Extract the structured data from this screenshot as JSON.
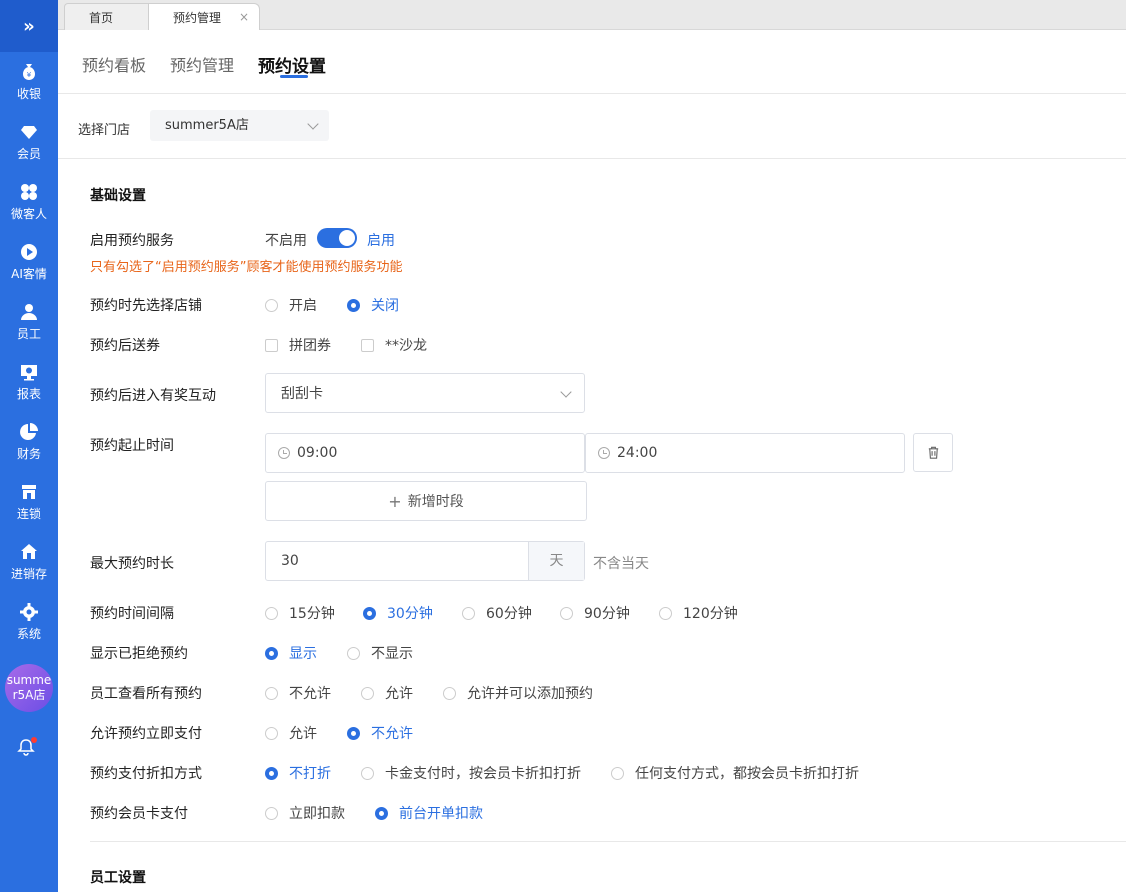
{
  "sidebar": {
    "top_icon": "»",
    "items": [
      {
        "label": "收银",
        "icon": "money-bag-icon"
      },
      {
        "label": "会员",
        "icon": "diamond-icon"
      },
      {
        "label": "微客人",
        "icon": "clover-icon"
      },
      {
        "label": "AI客情",
        "icon": "play-icon"
      },
      {
        "label": "员工",
        "icon": "person-icon"
      },
      {
        "label": "报表",
        "icon": "monitor-icon"
      },
      {
        "label": "财务",
        "icon": "pie-chart-icon"
      },
      {
        "label": "连锁",
        "icon": "store-icon"
      },
      {
        "label": "进销存",
        "icon": "house-icon"
      },
      {
        "label": "系统",
        "icon": "gear-icon"
      }
    ],
    "avatar_text": "summer5A店",
    "bell_icon": "bell-icon"
  },
  "tabs": {
    "home": "首页",
    "current": "预约管理",
    "close": "×"
  },
  "subnav": {
    "board": "预约看板",
    "manage": "预约管理",
    "settings": "预约设置"
  },
  "store": {
    "label": "选择门店",
    "value": "summer5A店"
  },
  "basic": {
    "title": "基础设置",
    "enable": {
      "label": "启用预约服务",
      "off": "不启用",
      "on": "启用",
      "warning": "只有勾选了“启用预约服务”顾客才能使用预约服务功能"
    },
    "choose_store": {
      "label": "预约时先选择店铺",
      "opt1": "开启",
      "opt2": "关闭"
    },
    "coupon": {
      "label": "预约后送券",
      "opt1": "拼团券",
      "opt2": "**沙龙"
    },
    "interaction": {
      "label": "预约后进入有奖互动",
      "value": "刮刮卡"
    },
    "time_range": {
      "label": "预约起止时间",
      "start": "09:00",
      "end": "24:00",
      "add": "新增时段"
    },
    "max_duration": {
      "label": "最大预约时长",
      "value": "30",
      "unit": "天",
      "hint": "不含当天"
    },
    "interval": {
      "label": "预约时间间隔",
      "opts": [
        "15分钟",
        "30分钟",
        "60分钟",
        "90分钟",
        "120分钟"
      ],
      "selected": 1
    },
    "show_rejected": {
      "label": "显示已拒绝预约",
      "opt1": "显示",
      "opt2": "不显示"
    },
    "staff_view": {
      "label": "员工查看所有预约",
      "opt1": "不允许",
      "opt2": "允许",
      "opt3": "允许并可以添加预约"
    },
    "pay_now": {
      "label": "允许预约立即支付",
      "opt1": "允许",
      "opt2": "不允许"
    },
    "discount": {
      "label": "预约支付折扣方式",
      "opt1": "不打折",
      "opt2": "卡金支付时，按会员卡折扣打折",
      "opt3": "任何支付方式，都按会员卡折扣打折"
    },
    "member_pay": {
      "label": "预约会员卡支付",
      "opt1": "立即扣款",
      "opt2": "前台开单扣款"
    }
  },
  "staff": {
    "title": "员工设置"
  },
  "colors": {
    "primary": "#2b6fe0",
    "warning": "#e8651a",
    "sidebar": "#2b6fe0"
  }
}
